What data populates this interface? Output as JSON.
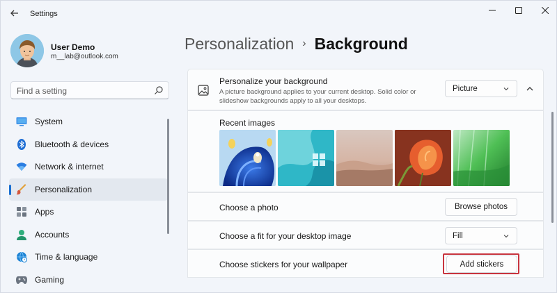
{
  "window": {
    "app_title": "Settings",
    "back_icon": "arrow-left-icon",
    "controls": [
      "minimize-icon",
      "maximize-icon",
      "close-icon"
    ]
  },
  "profile": {
    "name": "User Demo",
    "email": "m__lab@outlook.com"
  },
  "search": {
    "placeholder": "Find a setting",
    "value": ""
  },
  "nav": {
    "items": [
      {
        "label": "System",
        "icon": "monitor-icon",
        "active": false
      },
      {
        "label": "Bluetooth & devices",
        "icon": "bluetooth-icon",
        "active": false
      },
      {
        "label": "Network & internet",
        "icon": "wifi-icon",
        "active": false
      },
      {
        "label": "Personalization",
        "icon": "brush-icon",
        "active": true
      },
      {
        "label": "Apps",
        "icon": "apps-icon",
        "active": false
      },
      {
        "label": "Accounts",
        "icon": "person-icon",
        "active": false
      },
      {
        "label": "Time & language",
        "icon": "globe-clock-icon",
        "active": false
      },
      {
        "label": "Gaming",
        "icon": "gamepad-icon",
        "active": false
      }
    ]
  },
  "header": {
    "parent": "Personalization",
    "separator": "›",
    "current": "Background"
  },
  "background": {
    "title": "Personalize your background",
    "description": "A picture background applies to your current desktop. Solid color or slideshow backgrounds apply to all your desktops.",
    "type_value": "Picture",
    "recent_label": "Recent images",
    "choose_photo_label": "Choose a photo",
    "browse_label": "Browse photos",
    "fit_label": "Choose a fit for your desktop image",
    "fit_value": "Fill",
    "stickers_label": "Choose stickers for your wallpaper",
    "stickers_button": "Add stickers"
  },
  "colors": {
    "accent": "#1a6fd1",
    "highlight_box": "#c8343e"
  }
}
